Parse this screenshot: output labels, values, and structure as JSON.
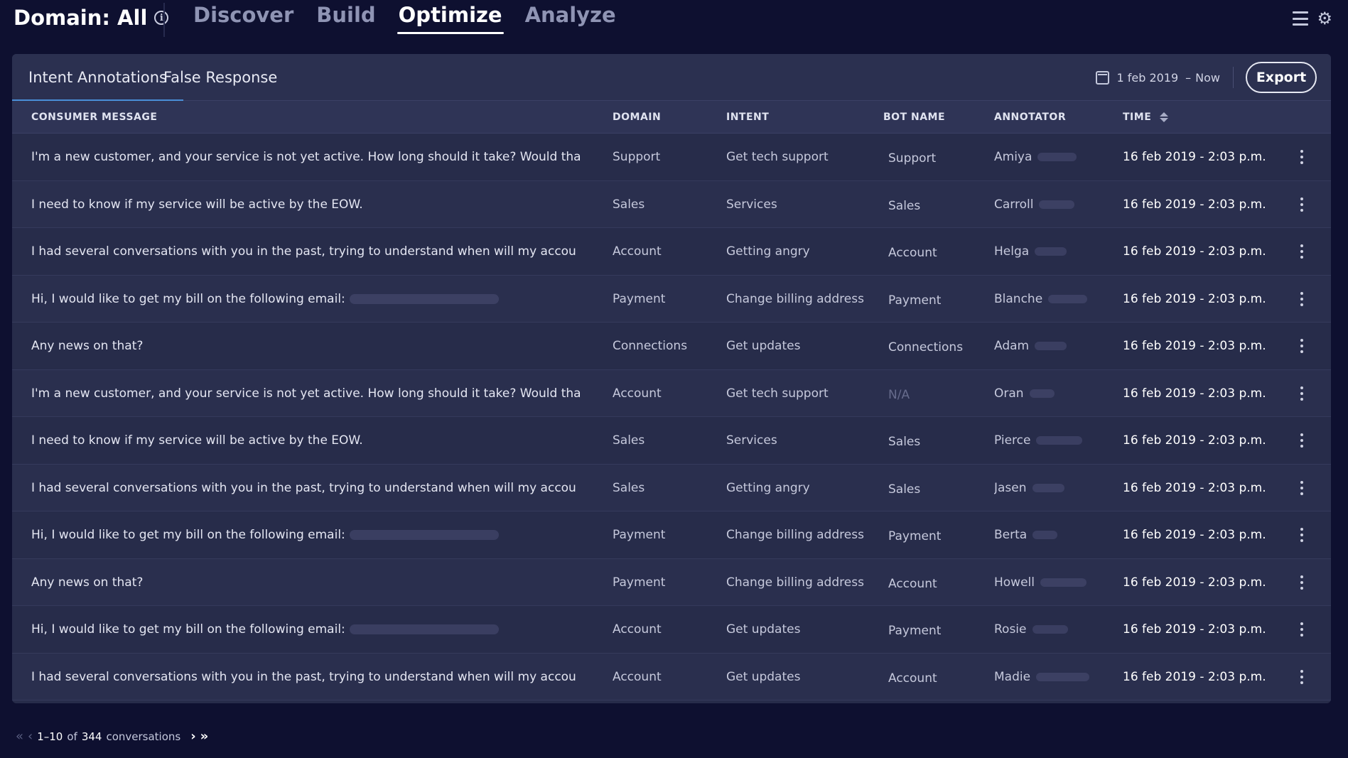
{
  "header": {
    "domain_title": "Domain: All",
    "nav": [
      {
        "label": "Discover",
        "active": false
      },
      {
        "label": "Build",
        "active": false
      },
      {
        "label": "Optimize",
        "active": true
      },
      {
        "label": "Analyze",
        "active": false
      }
    ],
    "icons": [
      "info-icon",
      "list-icon",
      "gear-icon"
    ]
  },
  "tabs": [
    {
      "label": "Intent Annotations",
      "active": true
    },
    {
      "label": "False Response",
      "active": false
    }
  ],
  "date_range": {
    "start": "1 feb 2019",
    "separator": "–",
    "end": "Now"
  },
  "export_label": "Export",
  "columns": {
    "message": "CONSUMER MESSAGE",
    "domain": "DOMAIN",
    "intent": "INTENT",
    "bot": "BOT NAME",
    "annotator": "ANNOTATOR",
    "time": "TIME"
  },
  "rows": [
    {
      "message": "I'm a new customer, and your service is not yet active. How long should it take? Would tha",
      "domain": "Support",
      "intent": "Get tech support",
      "bot": "Support",
      "annotator": "Amiya",
      "time": "16 feb 2019 - 2:03 p.m."
    },
    {
      "message": "I need to know if my service will be active by the EOW.",
      "domain": "Sales",
      "intent": "Services",
      "bot": "Sales",
      "annotator": "Carroll",
      "time": "16 feb 2019 - 2:03 p.m."
    },
    {
      "message": "I had several conversations with you in the past, trying to understand when will my accou",
      "domain": "Account",
      "intent": "Getting angry",
      "bot": "Account",
      "annotator": "Helga",
      "time": "16 feb 2019 - 2:03 p.m."
    },
    {
      "message": "Hi, I would like to get my bill on the following email:",
      "domain": "Payment",
      "intent": "Change billing address",
      "bot": "Payment",
      "annotator": "Blanche",
      "time": "16 feb 2019 - 2:03 p.m."
    },
    {
      "message": "Any news on that?",
      "domain": "Connections",
      "intent": "Get updates",
      "bot": "Connections",
      "annotator": "Adam",
      "time": "16 feb 2019 - 2:03 p.m."
    },
    {
      "message": "I'm a new customer, and your service is not yet active. How long should it take? Would tha",
      "domain": "Account",
      "intent": "Get tech support",
      "bot": "N/A",
      "annotator": "Oran",
      "time": "16 feb 2019 - 2:03 p.m."
    },
    {
      "message": "I need to know if my service will be active by the EOW.",
      "domain": "Sales",
      "intent": "Services",
      "bot": "Sales",
      "annotator": "Pierce",
      "time": "16 feb 2019 - 2:03 p.m."
    },
    {
      "message": "I had several conversations with you in the past, trying to understand when will my accou",
      "domain": "Sales",
      "intent": "Getting angry",
      "bot": "Sales",
      "annotator": "Jasen",
      "time": "16 feb 2019 - 2:03 p.m."
    },
    {
      "message": "Hi, I would like to get my bill on the following email:",
      "domain": "Payment",
      "intent": "Change billing address",
      "bot": "Payment",
      "annotator": "Berta",
      "time": "16 feb 2019 - 2:03 p.m."
    },
    {
      "message": "Any news on that?",
      "domain": "Payment",
      "intent": "Change billing address",
      "bot": "Account",
      "annotator": "Howell",
      "time": "16 feb 2019 - 2:03 p.m."
    },
    {
      "message": "Hi, I would like to get my bill on the following email:",
      "domain": "Account",
      "intent": "Get updates",
      "bot": "Payment",
      "annotator": "Rosie",
      "time": "16 feb 2019 - 2:03 p.m."
    },
    {
      "message": "I had several conversations with you in the past, trying to understand when will my accou",
      "domain": "Account",
      "intent": "Get updates",
      "bot": "Account",
      "annotator": "Madie",
      "time": "16 feb 2019 - 2:03 p.m."
    }
  ],
  "pagination": {
    "range": "1–10",
    "of": "of",
    "total": "344",
    "unit": "conversations"
  },
  "colors": {
    "background": "#0e1030",
    "card": "#272c4a",
    "accent": "#4a8fd8"
  }
}
